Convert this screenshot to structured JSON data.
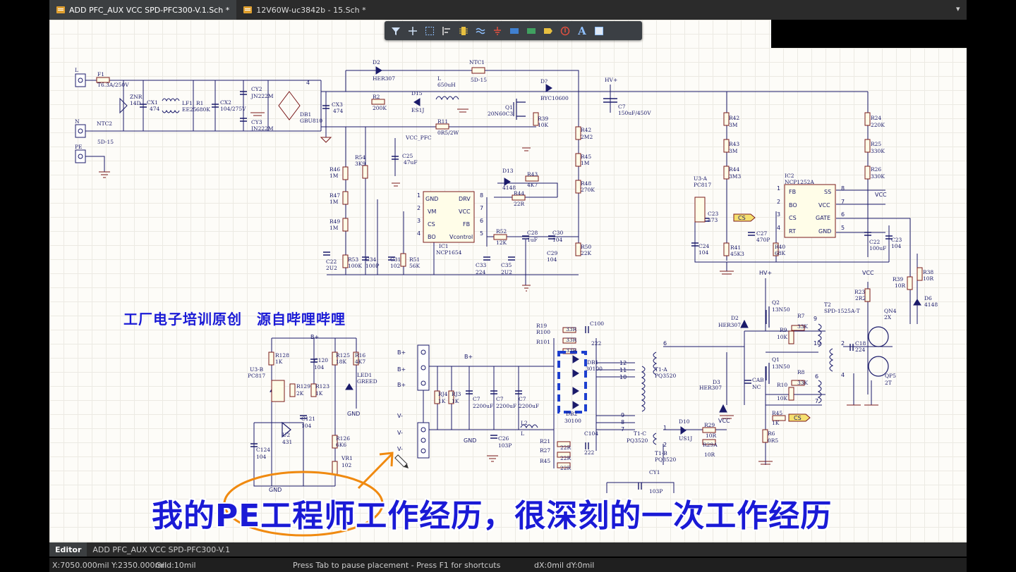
{
  "tabs": [
    {
      "label": "ADD PFC_AUX VCC SPD-PFC300-V.1.Sch *",
      "active": true
    },
    {
      "label": "12V60W-uc3842b - 15.Sch *",
      "active": false
    }
  ],
  "toolbar": {
    "tools": [
      "filter-icon",
      "crosshair-icon",
      "select-rect-icon",
      "align-icon",
      "component-icon",
      "bus-icon",
      "ground-icon",
      "harness-icon",
      "net-label-icon",
      "port-icon",
      "no-erc-icon",
      "text-icon",
      "rectangle-icon"
    ],
    "text_glyph": "A"
  },
  "schematic": {
    "labels": {
      "L": "L",
      "N": "N",
      "PE": "PE",
      "F1": "F1",
      "F1v": "T6.3A/250V",
      "NTC2": "NTC2",
      "NTC2v": "5D-15",
      "ZNR": "ZNR",
      "ZNRv": "14D",
      "CX1": "CX1",
      "CX1v": "474",
      "LF1": "LF1",
      "LF1v": "EE25",
      "R1": "R1",
      "R1v": "680K",
      "CX2": "CX2",
      "CX2v": "104/275V",
      "CY2": "CY2",
      "CY2v": "JN222M",
      "CY3": "CY3",
      "CY3v": "JN222M",
      "DB1": "DB1",
      "DB1v": "GBU810",
      "CX3": "CX3",
      "CX3v": "474",
      "D2": "D2",
      "D2v": "HER307",
      "NTC1": "NTC1",
      "NTC1v": "5D-15",
      "R2": "R2",
      "R2v": "200K",
      "D15": "D15",
      "D15v": "ES1J",
      "L1": "L",
      "L1v": "650uH",
      "Q1": "Q1",
      "Q1v": "20N60C3",
      "Dq": "D?",
      "Dqv": "BYC10600",
      "HV": "HV+",
      "C7": "C7",
      "C7v": "150uF/450V",
      "R39": "R39",
      "R39v": "10K",
      "R11": "R11",
      "R11v": "0R5/2W",
      "VCCPFC": "VCC_PFC",
      "C25": "C25",
      "C25v": "47uF",
      "R42": "R42",
      "R42v": "2M2",
      "R45": "R45",
      "R45v": "1M",
      "R48": "R48",
      "R48v": "270K",
      "R54": "R54",
      "R54v": "3K9",
      "R46": "R46",
      "R46v": "1M",
      "R47": "R47",
      "R47v": "1M",
      "R49": "R49",
      "R49v": "1M",
      "D13": "D13",
      "D13v": "4148",
      "R43": "R43",
      "R43v": "4K7",
      "R44": "R44",
      "R44v": "22R",
      "IC1": "IC1",
      "IC1v": "NCP1654",
      "p1": "GND",
      "p2": "VM",
      "p3": "CS",
      "p4": "BO",
      "p8": "DRV",
      "p7": "VCC",
      "p6": "FB",
      "p5": "Vcontrol",
      "R52": "R52",
      "R52v": "12K",
      "C28": "C28",
      "C28v": "1uF",
      "C30": "C30",
      "C30v": "104",
      "C29": "C29",
      "C29v": "104",
      "R50": "R50",
      "R50v": "22K",
      "C33": "C33",
      "C33v": "224",
      "C35": "C35",
      "C35v": "2U2",
      "C22a": "C22",
      "C22av": "2U2",
      "R53": "R53",
      "R53v": "100K",
      "C34": "C34",
      "C34v": "100P",
      "C31": "C31",
      "C31v": "102",
      "R51": "R51",
      "R51v": "56K",
      "R42b": "R42",
      "R42bv": "3M",
      "R43b": "R43",
      "R43bv": "3M",
      "R44b": "R44",
      "R44bv": "3M3",
      "R24": "R24",
      "R24v": "220K",
      "R25": "R25",
      "R25v": "330K",
      "R26": "R26",
      "R26v": "330K",
      "U3A": "U3-A",
      "U3Av": "PC817",
      "IC2": "IC2",
      "IC2v": "NCP1252A",
      "i2p1": "FB",
      "i2p2": "BO",
      "i2p3": "CS",
      "i2p4": "RT",
      "i2p8": "SS",
      "i2p7": "VCC",
      "i2p6": "GATE",
      "i2p5": "GND",
      "C23": "C23",
      "C23v": "473",
      "CS": "CS",
      "C27": "C27",
      "C27v": "470P",
      "C24": "C24",
      "C24v": "104",
      "R41": "R41",
      "R41v": "45K3",
      "R40": "R40",
      "R40v": "68K",
      "C22b": "C22",
      "C22bv": "100uF",
      "C23b": "C23",
      "C23bv": "104",
      "VCC": "VCC",
      "R39b": "R39",
      "R39bv": "10R",
      "R38": "R38",
      "R38v": "10R",
      "D6": "D6",
      "D6v": "4148",
      "R23": "R23",
      "R23v": "2R2",
      "QN4": "QN4",
      "QN4v": "2X",
      "QP5": "QP5",
      "QP5v": "2T",
      "Q2": "Q2",
      "Q2v": "13N50",
      "Q1b": "Q1",
      "Q1bv": "13N50",
      "R7": "R7",
      "R7v": "33K",
      "R9": "R9",
      "R9v": "10K",
      "R8": "R8",
      "R8v": "33K",
      "R10": "R10",
      "R10v": "10K",
      "T2": "T2",
      "T2v": "SPD-1525A-T",
      "C18": "C18",
      "C18v": "224",
      "D2b": "D2",
      "D2bv": "HER307",
      "D3": "D3",
      "D3v": "HER307",
      "CAB": "CAB",
      "CABv": "NC",
      "R45b": "R45",
      "R45bv": "1K",
      "R6": "R6",
      "R6v": "0R5",
      "T1A": "T1-A",
      "T1Av": "PQ3520",
      "T1C": "T1-C",
      "T1Cv": "PQ3520",
      "T1B": "T1-B",
      "T1Bv": "PQ3520",
      "D10": "D10",
      "D10v": "US1J",
      "R29": "R29",
      "R29v": "10R",
      "R29A": "R29A",
      "R29Av": "10R",
      "CY1": "CY1",
      "CY1v": "103P",
      "R19": "R19",
      "R100": "R100",
      "R101": "R101",
      "R33v": "33R",
      "C100": "C100",
      "C100v": "222",
      "DB1b": "DB1",
      "DB1bv": "30100",
      "DB2": "DB2",
      "DB2v": "30100",
      "Bp": "B+",
      "Vm": "V-",
      "RJ4": "RJ4",
      "RJ4v": "1K",
      "RJ3": "RJ3",
      "RJ3v": "1K",
      "C7a": "C7",
      "C7av": "2200uF",
      "C7b": "C7",
      "C7bv": "2200uF",
      "C7c": "C7",
      "C7cv": "2200uF",
      "GND": "GND",
      "C26": "C26",
      "C26v": "103P",
      "L2": "L2",
      "L2v": "L",
      "R21": "R21",
      "R27": "R27",
      "R45c": "R45",
      "R22v": "22R",
      "C104": "C104",
      "C104v": "222",
      "R128": "R128",
      "R128v": "1K",
      "R125": "R125",
      "R125v": "18K",
      "R16": "R16",
      "R16v": "4K7",
      "C120": "C120",
      "C120v": "104",
      "U3B": "U3-B",
      "U3Bv": "PC817",
      "LED1": "LED1",
      "LED1v": "GREED",
      "R129": "R129",
      "R129v": "2K",
      "R123": "R123",
      "R123v": "1K",
      "C121": "C121",
      "C121v": "104",
      "U2": "U2",
      "U2v": "431",
      "C124": "C124",
      "C124v": "104",
      "R126": "R126",
      "R126v": "6K6",
      "VR1": "VR1",
      "VR1v": "102"
    }
  },
  "captions": {
    "top": "工厂电子培训原创　源自哔哩哔哩",
    "bottom": "我的PE工程师工作经历，很深刻的一次工作经历"
  },
  "editor_bar": {
    "tabs": [
      {
        "label": "Editor",
        "active": true
      },
      {
        "label": "ADD PFC_AUX VCC SPD-PFC300-V.1",
        "active": false
      }
    ]
  },
  "status_bar": {
    "coords": "X:7050.000mil Y:2350.000mil",
    "grid": "Grid:10mil",
    "message": "Press Tab to pause placement - Press F1 for shortcuts",
    "delta": "dX:0mil dY:0mil"
  },
  "colors": {
    "wire": "#1a1a6a",
    "component": "#7a1a1a",
    "caption": "#1a1ad6",
    "annotation": "#f08a10",
    "net_flag": "#f5e070"
  }
}
